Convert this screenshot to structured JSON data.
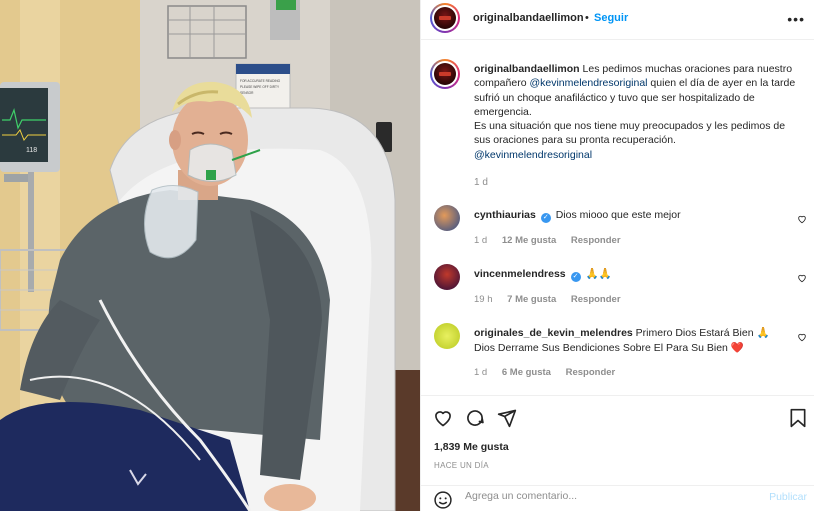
{
  "post": {
    "image_alt": "Hospital photo",
    "monitor_reading": "118",
    "sign_lines": [
      "FOR ACCURATE READING",
      "PLEASE WIPE OFF DIRTY",
      "SENSOR"
    ]
  },
  "header": {
    "username": "originalbandaellimon",
    "separator": "•",
    "follow_label": "Seguir",
    "more_label": "•••"
  },
  "caption": {
    "username": "originalbandaellimon",
    "text_1": " Les pedimos muchas oraciones para nuestro compañero ",
    "mention_1": "@kevinmelendresoriginal",
    "text_2": " quien el día de ayer en la tarde sufrió un choque anafiláctico y tuvo que ser hospitalizado de emergencia.",
    "text_3": "Es una situación que nos tiene muy preocupados y les pedimos de sus oraciones para su pronta recuperación.",
    "mention_2": "@kevinmelendresoriginal",
    "time": "1 d"
  },
  "comments": [
    {
      "username": "cynthiaurias",
      "verified": true,
      "text": "Dios miooo que este mejor",
      "time": "1 d",
      "likes": "12 Me gusta",
      "reply": "Responder",
      "avatar_color": "#2b4a8a"
    },
    {
      "username": "vincenmelendress",
      "verified": true,
      "text": "🙏🙏",
      "time": "19 h",
      "likes": "7 Me gusta",
      "reply": "Responder",
      "avatar_color": "#7a1a1a"
    },
    {
      "username": "originales_de_kevin_melendres",
      "verified": false,
      "text": "Primero Dios Estará Bien 🙏 Dios Derrame Sus Bendiciones Sobre El Para Su Bien ❤️",
      "time": "1 d",
      "likes": "6 Me gusta",
      "reply": "Responder",
      "avatar_color": "#c8d92a"
    }
  ],
  "footer": {
    "likes": "1,839 Me gusta",
    "ago": "HACE UN DÍA",
    "comment_placeholder": "Agrega un comentario...",
    "publish_label": "Publicar"
  },
  "icons": {
    "like": "heart-icon",
    "comment": "comment-icon",
    "share": "share-icon",
    "save": "bookmark-icon",
    "emoji": "emoji-icon",
    "more": "more-icon",
    "verified": "verified-badge-icon"
  },
  "colors": {
    "link": "#0095f6",
    "mention": "#00376b",
    "muted": "#8e8e8e",
    "verified": "#3897f0"
  }
}
